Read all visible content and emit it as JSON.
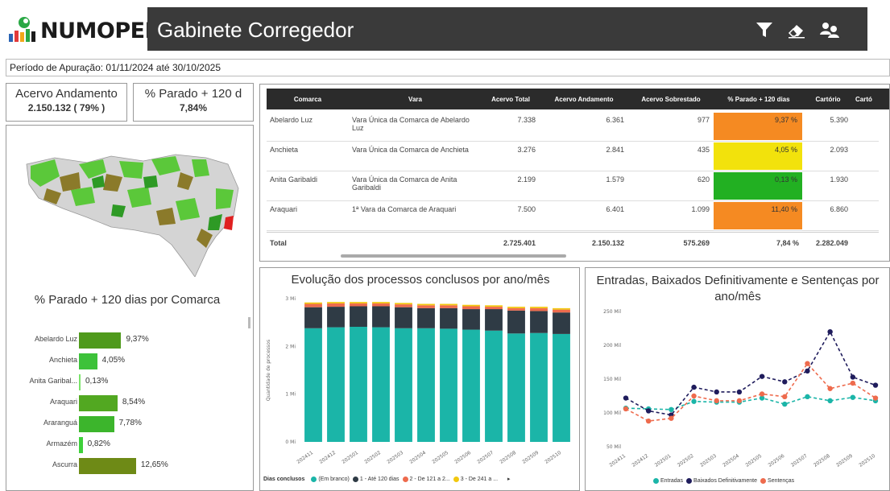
{
  "header": {
    "brand": "NUMOPEDE",
    "title": "Gabinete Corregedor"
  },
  "toolbar": {
    "icons": [
      "filter-icon",
      "eraser-icon",
      "user-switch-icon"
    ]
  },
  "period": "Período de Apuração: 01/11/2024 até 30/10/2025",
  "cards": [
    {
      "label": "Acervo Andamento",
      "value": "2.150.132 ( 79% )"
    },
    {
      "label": "% Parado + 120 d",
      "value": "7,84%"
    }
  ],
  "map_panel": {
    "title": "% Parado + 120 dias por Comarca",
    "bars": [
      {
        "label": "Abelardo Luz",
        "value": 9.37,
        "text": "9,37%",
        "color": "#4f9a1c"
      },
      {
        "label": "Anchieta",
        "value": 4.05,
        "text": "4,05%",
        "color": "#3dc23a"
      },
      {
        "label": "Anita Garibal...",
        "value": 0.13,
        "text": "0,13%",
        "color": "#7be36b"
      },
      {
        "label": "Araquari",
        "value": 8.54,
        "text": "8,54%",
        "color": "#52a821"
      },
      {
        "label": "Araranguá",
        "value": 7.78,
        "text": "7,78%",
        "color": "#3cb52c"
      },
      {
        "label": "Armazém",
        "value": 0.82,
        "text": "0,82%",
        "color": "#3ed13a"
      },
      {
        "label": "Ascurra",
        "value": 12.65,
        "text": "12,65%",
        "color": "#6e8a16"
      }
    ]
  },
  "table": {
    "columns": [
      "Comarca",
      "Vara",
      "Acervo Total",
      "Acervo Andamento",
      "Acervo Sobrestado",
      "% Parado + 120 dias",
      "Cartório",
      "Cartó"
    ],
    "rows": [
      {
        "comarca": "Abelardo Luz",
        "vara": "Vara Única da Comarca de Abelardo Luz",
        "total": "7.338",
        "andamento": "6.361",
        "sobrestado": "977",
        "pct": "9,37 %",
        "pct_color": "#f58a22",
        "cartorio": "5.390"
      },
      {
        "comarca": "Anchieta",
        "vara": "Vara Única da Comarca de Anchieta",
        "total": "3.276",
        "andamento": "2.841",
        "sobrestado": "435",
        "pct": "4,05 %",
        "pct_color": "#f2e20c",
        "cartorio": "2.093"
      },
      {
        "comarca": "Anita Garibaldi",
        "vara": "Vara Única da Comarca de Anita Garibaldi",
        "total": "2.199",
        "andamento": "1.579",
        "sobrestado": "620",
        "pct": "0,13 %",
        "pct_color": "#22b022",
        "cartorio": "1.930"
      },
      {
        "comarca": "Araquari",
        "vara": "1ª Vara da Comarca de Araquari",
        "total": "7.500",
        "andamento": "6.401",
        "sobrestado": "1.099",
        "pct": "11,40 %",
        "pct_color": "#f58a22",
        "cartorio": "6.860"
      }
    ],
    "total": {
      "label": "Total",
      "total": "2.725.401",
      "andamento": "2.150.132",
      "sobrestado": "575.269",
      "pct": "7,84 %",
      "cartorio": "2.282.049"
    }
  },
  "chart_data": [
    {
      "type": "bar",
      "title": "Evolução dos processos conclusos por ano/mês",
      "ylabel": "Quantidade de processos",
      "ylim": [
        0,
        3000000
      ],
      "y_ticks": [
        "0 Mi",
        "1 Mi",
        "2 Mi",
        "3 Mi"
      ],
      "categories": [
        "202411",
        "202412",
        "202501",
        "202502",
        "202503",
        "202504",
        "202505",
        "202506",
        "202507",
        "202508",
        "202509",
        "202510"
      ],
      "legend_title": "Dias conclusos",
      "series": [
        {
          "name": "(Em branco)",
          "color": "#1bb5a8",
          "values": [
            2380000,
            2400000,
            2410000,
            2400000,
            2380000,
            2380000,
            2370000,
            2350000,
            2330000,
            2270000,
            2280000,
            2260000
          ]
        },
        {
          "name": "1 - Até 120 dias",
          "color": "#2f3b45",
          "values": [
            440000,
            430000,
            430000,
            440000,
            440000,
            420000,
            430000,
            430000,
            450000,
            480000,
            460000,
            450000
          ]
        },
        {
          "name": "2 - De 121 a 2...",
          "color": "#ee6b4d",
          "values": [
            70000,
            70000,
            60000,
            60000,
            60000,
            60000,
            60000,
            60000,
            50000,
            50000,
            60000,
            60000
          ]
        },
        {
          "name": "3 - De 241 a ...",
          "color": "#f2c80f",
          "values": [
            30000,
            30000,
            30000,
            30000,
            30000,
            30000,
            30000,
            30000,
            30000,
            30000,
            30000,
            30000
          ]
        }
      ]
    },
    {
      "type": "line",
      "title": "Entradas, Baixados Definitivamente e Sentenças por ano/mês",
      "ylim": [
        50000,
        250000
      ],
      "y_ticks": [
        "50 Mil",
        "100 Mil",
        "150 Mil",
        "200 Mil",
        "250 Mil"
      ],
      "x": [
        "202411",
        "202412",
        "202501",
        "202502",
        "202503",
        "202504",
        "202505",
        "202506",
        "202507",
        "202508",
        "202509",
        "202510"
      ],
      "series": [
        {
          "name": "Entradas",
          "color": "#1bb5a8",
          "values": [
            107000,
            106000,
            105000,
            117000,
            116000,
            116000,
            122000,
            113000,
            124000,
            118000,
            123000,
            118000
          ]
        },
        {
          "name": "Baixados Definitivamente",
          "color": "#1f1c5c",
          "values": [
            122000,
            103000,
            97000,
            138000,
            131000,
            131000,
            154000,
            146000,
            162000,
            220000,
            153000,
            141000
          ]
        },
        {
          "name": "Sentenças",
          "color": "#ee6b4d",
          "values": [
            106000,
            88000,
            92000,
            125000,
            118000,
            118000,
            128000,
            124000,
            173000,
            136000,
            144000,
            122000
          ]
        }
      ]
    }
  ]
}
